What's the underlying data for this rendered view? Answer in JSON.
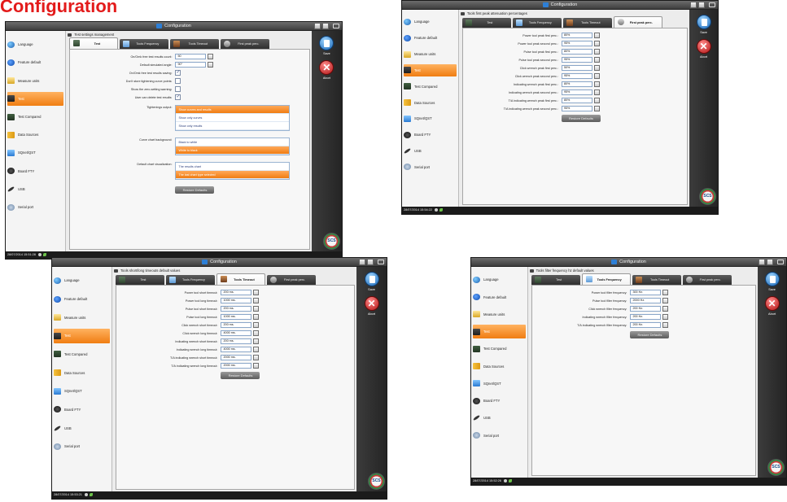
{
  "page": {
    "title": "Configuration"
  },
  "window": {
    "title": "Configuration"
  },
  "sidebar": {
    "items": [
      {
        "label": "Language",
        "icon": "globe-icon"
      },
      {
        "label": "Feature default",
        "icon": "feature-icon"
      },
      {
        "label": "Measure units",
        "icon": "ruler-icon"
      },
      {
        "label": "Test",
        "icon": "test-icon"
      },
      {
        "label": "Test Compared",
        "icon": "compare-icon"
      },
      {
        "label": "Data Sources",
        "icon": "database-icon"
      },
      {
        "label": "SQnet/QST",
        "icon": "network-icon"
      },
      {
        "label": "Board FTY",
        "icon": "board-icon"
      },
      {
        "label": "USB",
        "icon": "usb-icon"
      },
      {
        "label": "Serial port",
        "icon": "serial-port-icon"
      }
    ]
  },
  "tabs": [
    {
      "label": "Test",
      "icon": "test-tab-icon"
    },
    {
      "label": "Tools Frequency",
      "icon": "frequency-tab-icon"
    },
    {
      "label": "Tools Timeout",
      "icon": "timeout-tab-icon"
    },
    {
      "label": "First peak perc.",
      "icon": "first-peak-tab-icon"
    }
  ],
  "actions": {
    "save": "Save",
    "abort": "Abort",
    "restore": "Restore Defaults"
  },
  "screens": [
    {
      "header": "Test settings management",
      "selected_tab": 0,
      "timestamp": "28/07/2014 15:51:28",
      "rows": [
        {
          "label": "On/Omk free test results count:",
          "value": "50",
          "type": "number"
        },
        {
          "label": "Default simulated angle:",
          "value": "90°",
          "type": "number"
        },
        {
          "label": "On/Omk free test results saving:",
          "value": "✓",
          "type": "check"
        },
        {
          "label": "Don't store tightening curve points:",
          "value": "",
          "type": "check"
        },
        {
          "label": "Show the zero-setting warning:",
          "value": "",
          "type": "check"
        },
        {
          "label": "User can delete test results:",
          "value": "✓",
          "type": "check"
        }
      ],
      "lists": [
        {
          "label": "Tightenings output:",
          "options": [
            "Show curves and results",
            "Show only curves",
            "Show only results"
          ],
          "selected": 0
        },
        {
          "label": "Curve chart background:",
          "options": [
            "Black to white",
            "White to black"
          ],
          "selected": 1
        },
        {
          "label": "Default chart visualization:",
          "options": [
            "The results chart",
            "The last chart type selected"
          ],
          "selected": 1
        }
      ]
    },
    {
      "header": "Tools first peak attenuation percentages",
      "selected_tab": 3,
      "timestamp": "28/07/2014 15:54:22",
      "rows": [
        {
          "label": "Power tool peak first perc.:",
          "value": "80%"
        },
        {
          "label": "Power tool peak second perc.:",
          "value": "95%"
        },
        {
          "label": "Pulse tool peak first perc.:",
          "value": "80%"
        },
        {
          "label": "Pulse tool peak second perc.:",
          "value": "95%"
        },
        {
          "label": "Click wrench peak first perc.:",
          "value": "50%"
        },
        {
          "label": "Click wrench peak second perc.:",
          "value": "95%"
        },
        {
          "label": "Indicating wrench peak first perc.:",
          "value": "80%"
        },
        {
          "label": "Indicating wrench peak second perc.:",
          "value": "95%"
        },
        {
          "label": "T/A indicating wrench peak first perc.:",
          "value": "80%"
        },
        {
          "label": "T/A indicating wrench peak second perc.:",
          "value": "95%"
        }
      ]
    },
    {
      "header": "Tools short/long timeouts default values",
      "selected_tab": 2,
      "timestamp": "28/07/2014 15:53:21",
      "rows": [
        {
          "label": "Power tool short timeout:",
          "value": "200 ms."
        },
        {
          "label": "Power tool long timeout:",
          "value": "1000 ms."
        },
        {
          "label": "Pulse tool short timeout:",
          "value": "200 ms."
        },
        {
          "label": "Pulse tool long timeout:",
          "value": "1000 ms."
        },
        {
          "label": "Click wrench short timeout:",
          "value": "200 ms."
        },
        {
          "label": "Click wrench long timeout:",
          "value": "4000 ms."
        },
        {
          "label": "Indicating wrench short timeout:",
          "value": "200 ms."
        },
        {
          "label": "Indicating wrench long timeout:",
          "value": "4000 ms."
        },
        {
          "label": "T/A indicating wrench short timeout:",
          "value": "2000 ms."
        },
        {
          "label": "T/A indicating wrench long timeout:",
          "value": "2000 ms."
        }
      ]
    },
    {
      "header": "Tools filter frequency hz default values",
      "selected_tab": 1,
      "timestamp": "28/07/2014 15:52:26",
      "rows": [
        {
          "label": "Power tool filter frequency:",
          "value": "300 Hz."
        },
        {
          "label": "Pulse tool filter frequency:",
          "value": "2000 Hz."
        },
        {
          "label": "Click wrench filter frequency:",
          "value": "200 Hz."
        },
        {
          "label": "Indicating wrench filter frequency:",
          "value": "200 Hz."
        },
        {
          "label": "T/A indicating wrench filter frequency:",
          "value": "200 Hz."
        }
      ]
    }
  ],
  "logo": {
    "text": "SCS"
  },
  "colors": {
    "accent": "#f07d12",
    "title": "#e31b1b",
    "save": "#1a67b8",
    "abort": "#b11414"
  }
}
